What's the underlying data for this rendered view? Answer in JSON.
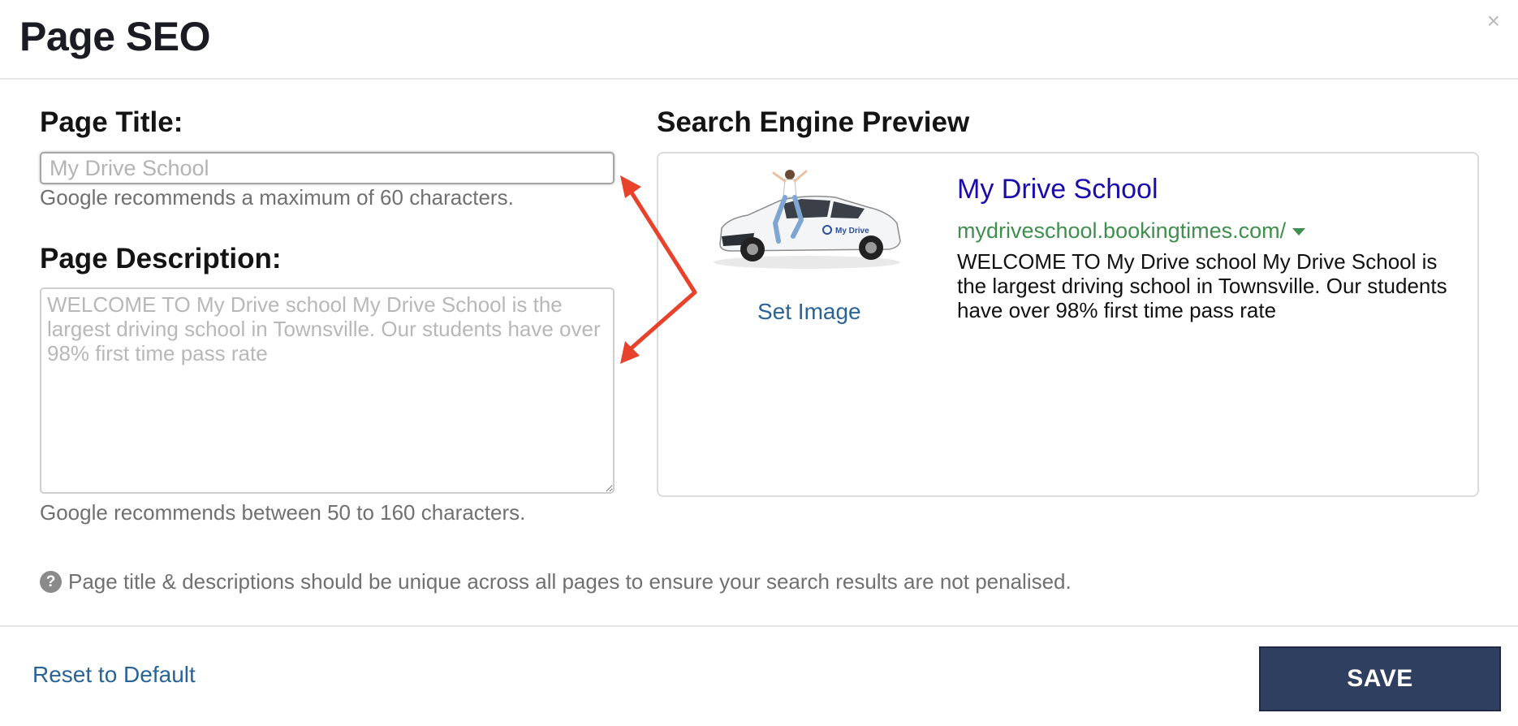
{
  "modal": {
    "title": "Page SEO",
    "close_icon": "×"
  },
  "form": {
    "page_title_label": "Page Title:",
    "page_title_placeholder": "My Drive School",
    "page_title_value": "",
    "page_title_hint": "Google recommends a maximum of 60 characters.",
    "page_description_label": "Page Description:",
    "page_description_placeholder": "WELCOME TO My Drive school My Drive School is the largest driving school in Townsville. Our students have over 98% first time pass rate",
    "page_description_value": "",
    "page_description_hint": "Google recommends between 50 to 160 characters."
  },
  "preview": {
    "heading": "Search Engine Preview",
    "set_image_label": "Set Image",
    "thumbnail_icon": "car-photo-icon",
    "thumbnail_brand_text": "My Drive",
    "result_title": "My Drive School",
    "result_url": "mydriveschool.bookingtimes.com/",
    "result_description": "WELCOME TO My Drive school My Drive School is the largest driving school in Townsville. Our students have over 98% first time pass rate"
  },
  "note": {
    "icon": "help-icon",
    "icon_glyph": "?",
    "text": "Page title & descriptions should be unique across all pages to ensure your search results are not penalised."
  },
  "footer": {
    "reset_label": "Reset to Default",
    "save_label": "SAVE"
  },
  "colors": {
    "serp_title": "#1a0dab",
    "serp_url": "#3f8f4e",
    "link": "#2a6496",
    "save_button": "#2f3f5f",
    "annotation_arrow": "#e8412c"
  }
}
